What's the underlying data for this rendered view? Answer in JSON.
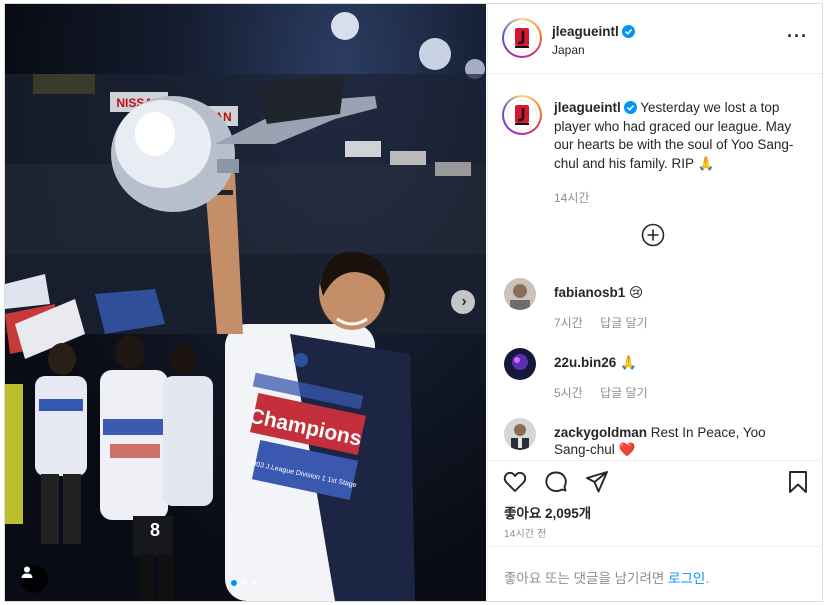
{
  "post": {
    "username": "jleagueintl",
    "location": "Japan",
    "caption": "Yesterday we lost a top player who had graced our league. May our hearts be with the soul of Yoo Sang-chul and his family. RIP 🙏",
    "caption_time": "14시간"
  },
  "photo": {
    "banner_text": "Champions",
    "shirt_small_text": "2003 J.League Division 1 1st Stage",
    "sponsor_text": "NISSAN",
    "player_number": "8"
  },
  "comments": [
    {
      "username": "fabianosb1",
      "text": "😢",
      "time": "7시간",
      "reply": "답글 달기"
    },
    {
      "username": "22u.bin26",
      "text": "🙏",
      "time": "5시간",
      "reply": "답글 달기"
    },
    {
      "username": "zackygoldman",
      "text": "Rest In Peace, Yoo Sang-chul ❤️",
      "time": "",
      "reply": ""
    }
  ],
  "likes": "좋아요 2,095개",
  "post_time": "14시간 전",
  "login_prompt": {
    "text": "좋아요 또는 댓글을 남기려면 ",
    "link": "로그인",
    "suffix": "."
  },
  "colors": {
    "link": "#0095f6",
    "verified": "#0095f6",
    "muted": "#8e8e8e"
  },
  "icons": [
    "more-icon",
    "verified-icon",
    "plus-circle-icon",
    "heart-icon",
    "comment-icon",
    "share-icon",
    "bookmark-icon",
    "user-tag-icon",
    "chevron-right-icon"
  ]
}
